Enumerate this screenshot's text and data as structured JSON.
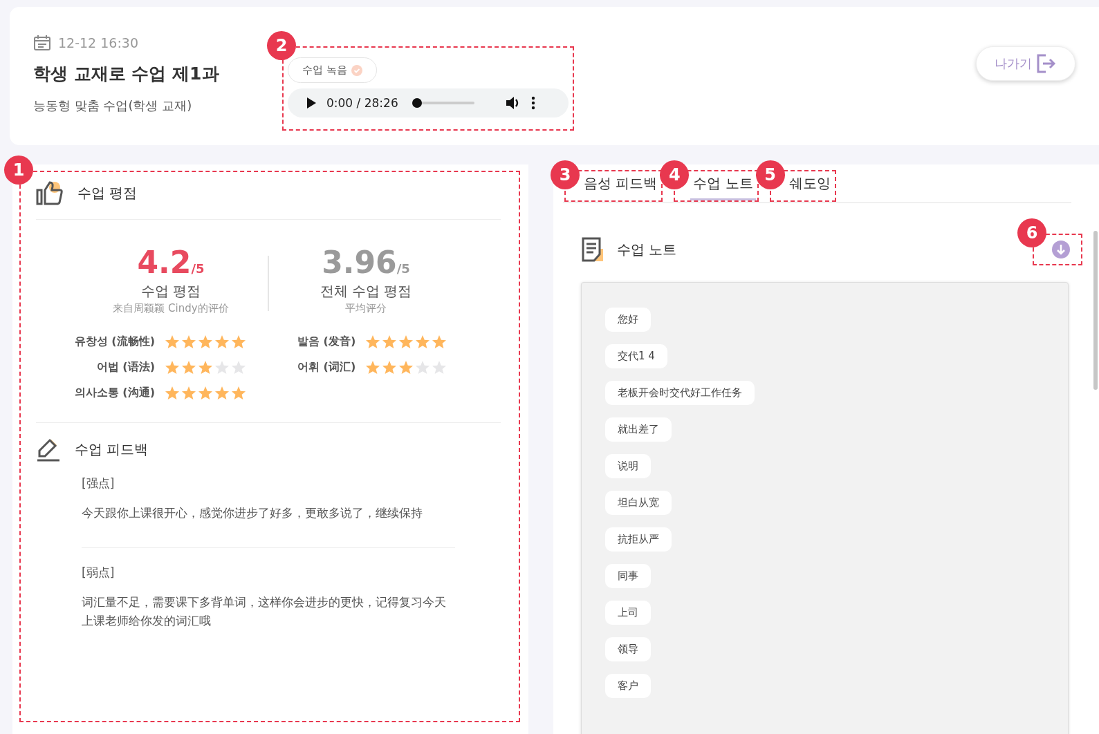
{
  "header": {
    "date": "12-12 16:30",
    "title": "학생 교재로 수업 제1과",
    "subtitle": "능동형 맞춤 수업(학생 교재)",
    "recording": {
      "callout": "2",
      "label": "수업 녹음",
      "time": "0:00 / 28:26",
      "level": 0
    },
    "exit_button": "나가기"
  },
  "rating_panel": {
    "callout": "1",
    "title": "수업 평점",
    "scores": [
      {
        "kind": "own",
        "value": "4.2",
        "out_of": "/5",
        "label": "수업 평점",
        "caption": "来自周颖颖 Cindy的评价"
      },
      {
        "kind": "average",
        "value": "3.96",
        "out_of": "/5",
        "label": "전체 수업 평점",
        "caption": "平均评分"
      }
    ],
    "criteria": [
      {
        "label": "유창성 (流畅性)",
        "stars": 5
      },
      {
        "label": "발음 (发音)",
        "stars": 5
      },
      {
        "label": "어법 (语法)",
        "stars": 3
      },
      {
        "label": "어휘 (词汇)",
        "stars": 3
      },
      {
        "label": "의사소통 (沟通)",
        "stars": 5
      }
    ],
    "feedback": {
      "title": "수업 피드백",
      "sections": [
        {
          "heading": "[强点]",
          "text": "今天跟你上课很开心，感觉你进步了好多，更敢多说了，继续保持"
        },
        {
          "heading": "[弱点]",
          "text": "词汇量不足，需要课下多背单词，这样你会进步的更快，记得复习今天上课老师给你发的词汇哦"
        }
      ]
    }
  },
  "notes_panel": {
    "tabs": [
      {
        "label": "음성 피드백",
        "selected": false,
        "callout": "3"
      },
      {
        "label": "수업 노트",
        "selected": true,
        "callout": "4"
      },
      {
        "label": "쉐도잉",
        "selected": false,
        "callout": "5"
      }
    ],
    "title": "수업 노트",
    "download_callout": "6",
    "notes": [
      "您好",
      "交代1 4",
      "老板开会时交代好工作任务",
      "就出差了",
      "说明",
      "坦白从宽",
      "抗拒从严",
      "同事",
      "上司",
      "领导",
      "客户"
    ]
  }
}
